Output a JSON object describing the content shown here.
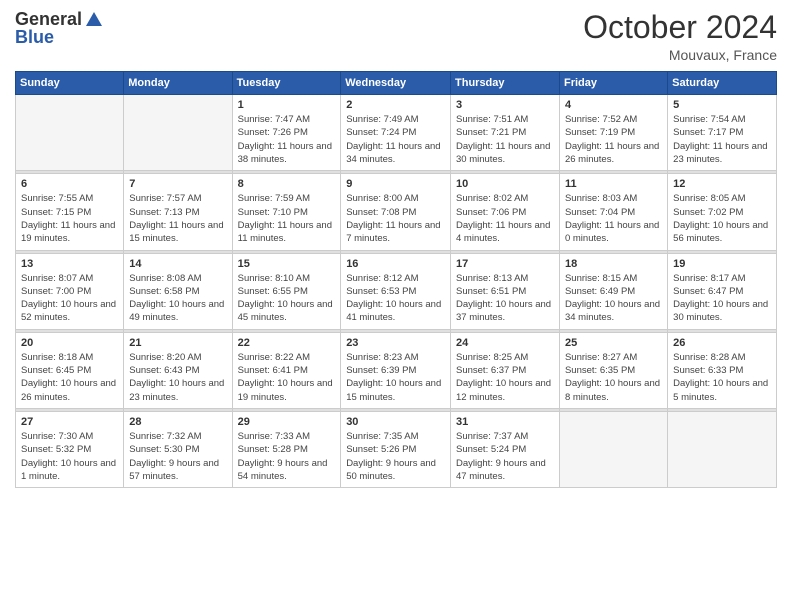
{
  "header": {
    "logo_general": "General",
    "logo_blue": "Blue",
    "title": "October 2024",
    "location": "Mouvaux, France"
  },
  "days_of_week": [
    "Sunday",
    "Monday",
    "Tuesday",
    "Wednesday",
    "Thursday",
    "Friday",
    "Saturday"
  ],
  "weeks": [
    [
      {
        "day": "",
        "sunrise": "",
        "sunset": "",
        "daylight": ""
      },
      {
        "day": "",
        "sunrise": "",
        "sunset": "",
        "daylight": ""
      },
      {
        "day": "1",
        "sunrise": "Sunrise: 7:47 AM",
        "sunset": "Sunset: 7:26 PM",
        "daylight": "Daylight: 11 hours and 38 minutes."
      },
      {
        "day": "2",
        "sunrise": "Sunrise: 7:49 AM",
        "sunset": "Sunset: 7:24 PM",
        "daylight": "Daylight: 11 hours and 34 minutes."
      },
      {
        "day": "3",
        "sunrise": "Sunrise: 7:51 AM",
        "sunset": "Sunset: 7:21 PM",
        "daylight": "Daylight: 11 hours and 30 minutes."
      },
      {
        "day": "4",
        "sunrise": "Sunrise: 7:52 AM",
        "sunset": "Sunset: 7:19 PM",
        "daylight": "Daylight: 11 hours and 26 minutes."
      },
      {
        "day": "5",
        "sunrise": "Sunrise: 7:54 AM",
        "sunset": "Sunset: 7:17 PM",
        "daylight": "Daylight: 11 hours and 23 minutes."
      }
    ],
    [
      {
        "day": "6",
        "sunrise": "Sunrise: 7:55 AM",
        "sunset": "Sunset: 7:15 PM",
        "daylight": "Daylight: 11 hours and 19 minutes."
      },
      {
        "day": "7",
        "sunrise": "Sunrise: 7:57 AM",
        "sunset": "Sunset: 7:13 PM",
        "daylight": "Daylight: 11 hours and 15 minutes."
      },
      {
        "day": "8",
        "sunrise": "Sunrise: 7:59 AM",
        "sunset": "Sunset: 7:10 PM",
        "daylight": "Daylight: 11 hours and 11 minutes."
      },
      {
        "day": "9",
        "sunrise": "Sunrise: 8:00 AM",
        "sunset": "Sunset: 7:08 PM",
        "daylight": "Daylight: 11 hours and 7 minutes."
      },
      {
        "day": "10",
        "sunrise": "Sunrise: 8:02 AM",
        "sunset": "Sunset: 7:06 PM",
        "daylight": "Daylight: 11 hours and 4 minutes."
      },
      {
        "day": "11",
        "sunrise": "Sunrise: 8:03 AM",
        "sunset": "Sunset: 7:04 PM",
        "daylight": "Daylight: 11 hours and 0 minutes."
      },
      {
        "day": "12",
        "sunrise": "Sunrise: 8:05 AM",
        "sunset": "Sunset: 7:02 PM",
        "daylight": "Daylight: 10 hours and 56 minutes."
      }
    ],
    [
      {
        "day": "13",
        "sunrise": "Sunrise: 8:07 AM",
        "sunset": "Sunset: 7:00 PM",
        "daylight": "Daylight: 10 hours and 52 minutes."
      },
      {
        "day": "14",
        "sunrise": "Sunrise: 8:08 AM",
        "sunset": "Sunset: 6:58 PM",
        "daylight": "Daylight: 10 hours and 49 minutes."
      },
      {
        "day": "15",
        "sunrise": "Sunrise: 8:10 AM",
        "sunset": "Sunset: 6:55 PM",
        "daylight": "Daylight: 10 hours and 45 minutes."
      },
      {
        "day": "16",
        "sunrise": "Sunrise: 8:12 AM",
        "sunset": "Sunset: 6:53 PM",
        "daylight": "Daylight: 10 hours and 41 minutes."
      },
      {
        "day": "17",
        "sunrise": "Sunrise: 8:13 AM",
        "sunset": "Sunset: 6:51 PM",
        "daylight": "Daylight: 10 hours and 37 minutes."
      },
      {
        "day": "18",
        "sunrise": "Sunrise: 8:15 AM",
        "sunset": "Sunset: 6:49 PM",
        "daylight": "Daylight: 10 hours and 34 minutes."
      },
      {
        "day": "19",
        "sunrise": "Sunrise: 8:17 AM",
        "sunset": "Sunset: 6:47 PM",
        "daylight": "Daylight: 10 hours and 30 minutes."
      }
    ],
    [
      {
        "day": "20",
        "sunrise": "Sunrise: 8:18 AM",
        "sunset": "Sunset: 6:45 PM",
        "daylight": "Daylight: 10 hours and 26 minutes."
      },
      {
        "day": "21",
        "sunrise": "Sunrise: 8:20 AM",
        "sunset": "Sunset: 6:43 PM",
        "daylight": "Daylight: 10 hours and 23 minutes."
      },
      {
        "day": "22",
        "sunrise": "Sunrise: 8:22 AM",
        "sunset": "Sunset: 6:41 PM",
        "daylight": "Daylight: 10 hours and 19 minutes."
      },
      {
        "day": "23",
        "sunrise": "Sunrise: 8:23 AM",
        "sunset": "Sunset: 6:39 PM",
        "daylight": "Daylight: 10 hours and 15 minutes."
      },
      {
        "day": "24",
        "sunrise": "Sunrise: 8:25 AM",
        "sunset": "Sunset: 6:37 PM",
        "daylight": "Daylight: 10 hours and 12 minutes."
      },
      {
        "day": "25",
        "sunrise": "Sunrise: 8:27 AM",
        "sunset": "Sunset: 6:35 PM",
        "daylight": "Daylight: 10 hours and 8 minutes."
      },
      {
        "day": "26",
        "sunrise": "Sunrise: 8:28 AM",
        "sunset": "Sunset: 6:33 PM",
        "daylight": "Daylight: 10 hours and 5 minutes."
      }
    ],
    [
      {
        "day": "27",
        "sunrise": "Sunrise: 7:30 AM",
        "sunset": "Sunset: 5:32 PM",
        "daylight": "Daylight: 10 hours and 1 minute."
      },
      {
        "day": "28",
        "sunrise": "Sunrise: 7:32 AM",
        "sunset": "Sunset: 5:30 PM",
        "daylight": "Daylight: 9 hours and 57 minutes."
      },
      {
        "day": "29",
        "sunrise": "Sunrise: 7:33 AM",
        "sunset": "Sunset: 5:28 PM",
        "daylight": "Daylight: 9 hours and 54 minutes."
      },
      {
        "day": "30",
        "sunrise": "Sunrise: 7:35 AM",
        "sunset": "Sunset: 5:26 PM",
        "daylight": "Daylight: 9 hours and 50 minutes."
      },
      {
        "day": "31",
        "sunrise": "Sunrise: 7:37 AM",
        "sunset": "Sunset: 5:24 PM",
        "daylight": "Daylight: 9 hours and 47 minutes."
      },
      {
        "day": "",
        "sunrise": "",
        "sunset": "",
        "daylight": ""
      },
      {
        "day": "",
        "sunrise": "",
        "sunset": "",
        "daylight": ""
      }
    ]
  ]
}
